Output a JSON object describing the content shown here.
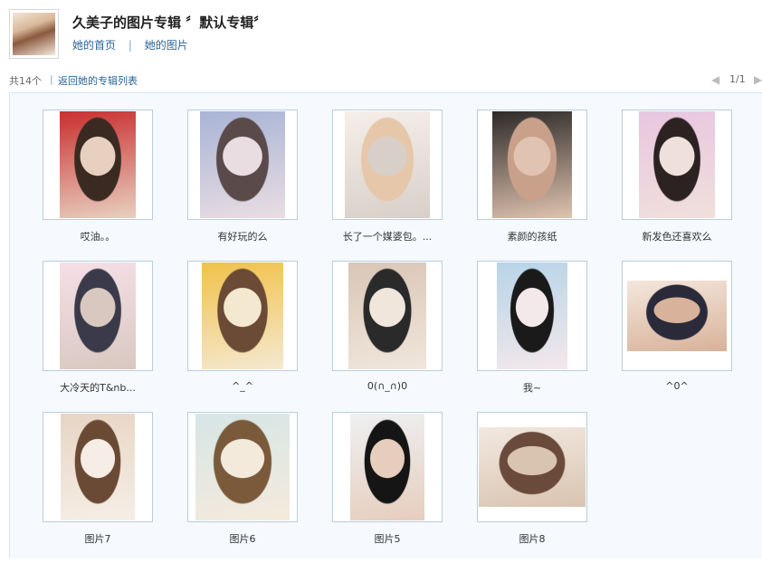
{
  "header": {
    "title": "久美子的图片专辑 〞默认专辑〞",
    "nav": [
      {
        "label": "她的首页"
      },
      {
        "label": "她的图片"
      }
    ],
    "nav_separator": "|"
  },
  "toolbar": {
    "count_text": "共14个",
    "separator": "|",
    "back_label": "返回她的专辑列表",
    "prev_icon": "left-arrow-icon",
    "page_text": "1/1",
    "next_icon": "right-arrow-icon"
  },
  "photos": [
    {
      "caption": "哎油。。",
      "palette": [
        "#c92f2f",
        "#3a2a22",
        "#e8d0c0"
      ]
    },
    {
      "caption": "有好玩的么",
      "palette": [
        "#a8b4d6",
        "#5a4a4a",
        "#e9dde2"
      ]
    },
    {
      "caption": "长了一个媒婆包。...",
      "palette": [
        "#f6eee8",
        "#e6c7aa",
        "#d7cfc8"
      ]
    },
    {
      "caption": "素颜的孩纸",
      "palette": [
        "#2d2a28",
        "#c9a08a",
        "#e0c3b0"
      ]
    },
    {
      "caption": "新发色还喜欢么",
      "palette": [
        "#e8c6e0",
        "#2d2222",
        "#efe0dc"
      ]
    },
    {
      "caption": "大冷天的T&nb...",
      "palette": [
        "#f5dfe6",
        "#3a3a4a",
        "#d8c8c0"
      ]
    },
    {
      "caption": "^_^",
      "palette": [
        "#f0c24a",
        "#6b4b35",
        "#f5e8d0"
      ]
    },
    {
      "caption": "0(∩_∩)0",
      "palette": [
        "#d9c6b6",
        "#2a2a2a",
        "#f0e6dc"
      ]
    },
    {
      "caption": "我~",
      "palette": [
        "#b7d4e8",
        "#1a1a1a",
        "#f3e8ea"
      ]
    },
    {
      "caption": "^0^",
      "palette": [
        "#f3e6dc",
        "#2a2a3a",
        "#d8b29a"
      ]
    },
    {
      "caption": "图片7",
      "palette": [
        "#e7d5c4",
        "#6a4a35",
        "#f6eee6"
      ]
    },
    {
      "caption": "图片6",
      "palette": [
        "#d6e6e6",
        "#7a5a3a",
        "#f4eadc"
      ]
    },
    {
      "caption": "图片5",
      "palette": [
        "#eef0f2",
        "#151515",
        "#e6cdbd"
      ]
    },
    {
      "caption": "图片8",
      "palette": [
        "#f2e8e0",
        "#6a4a3a",
        "#d8c4b0"
      ]
    }
  ]
}
